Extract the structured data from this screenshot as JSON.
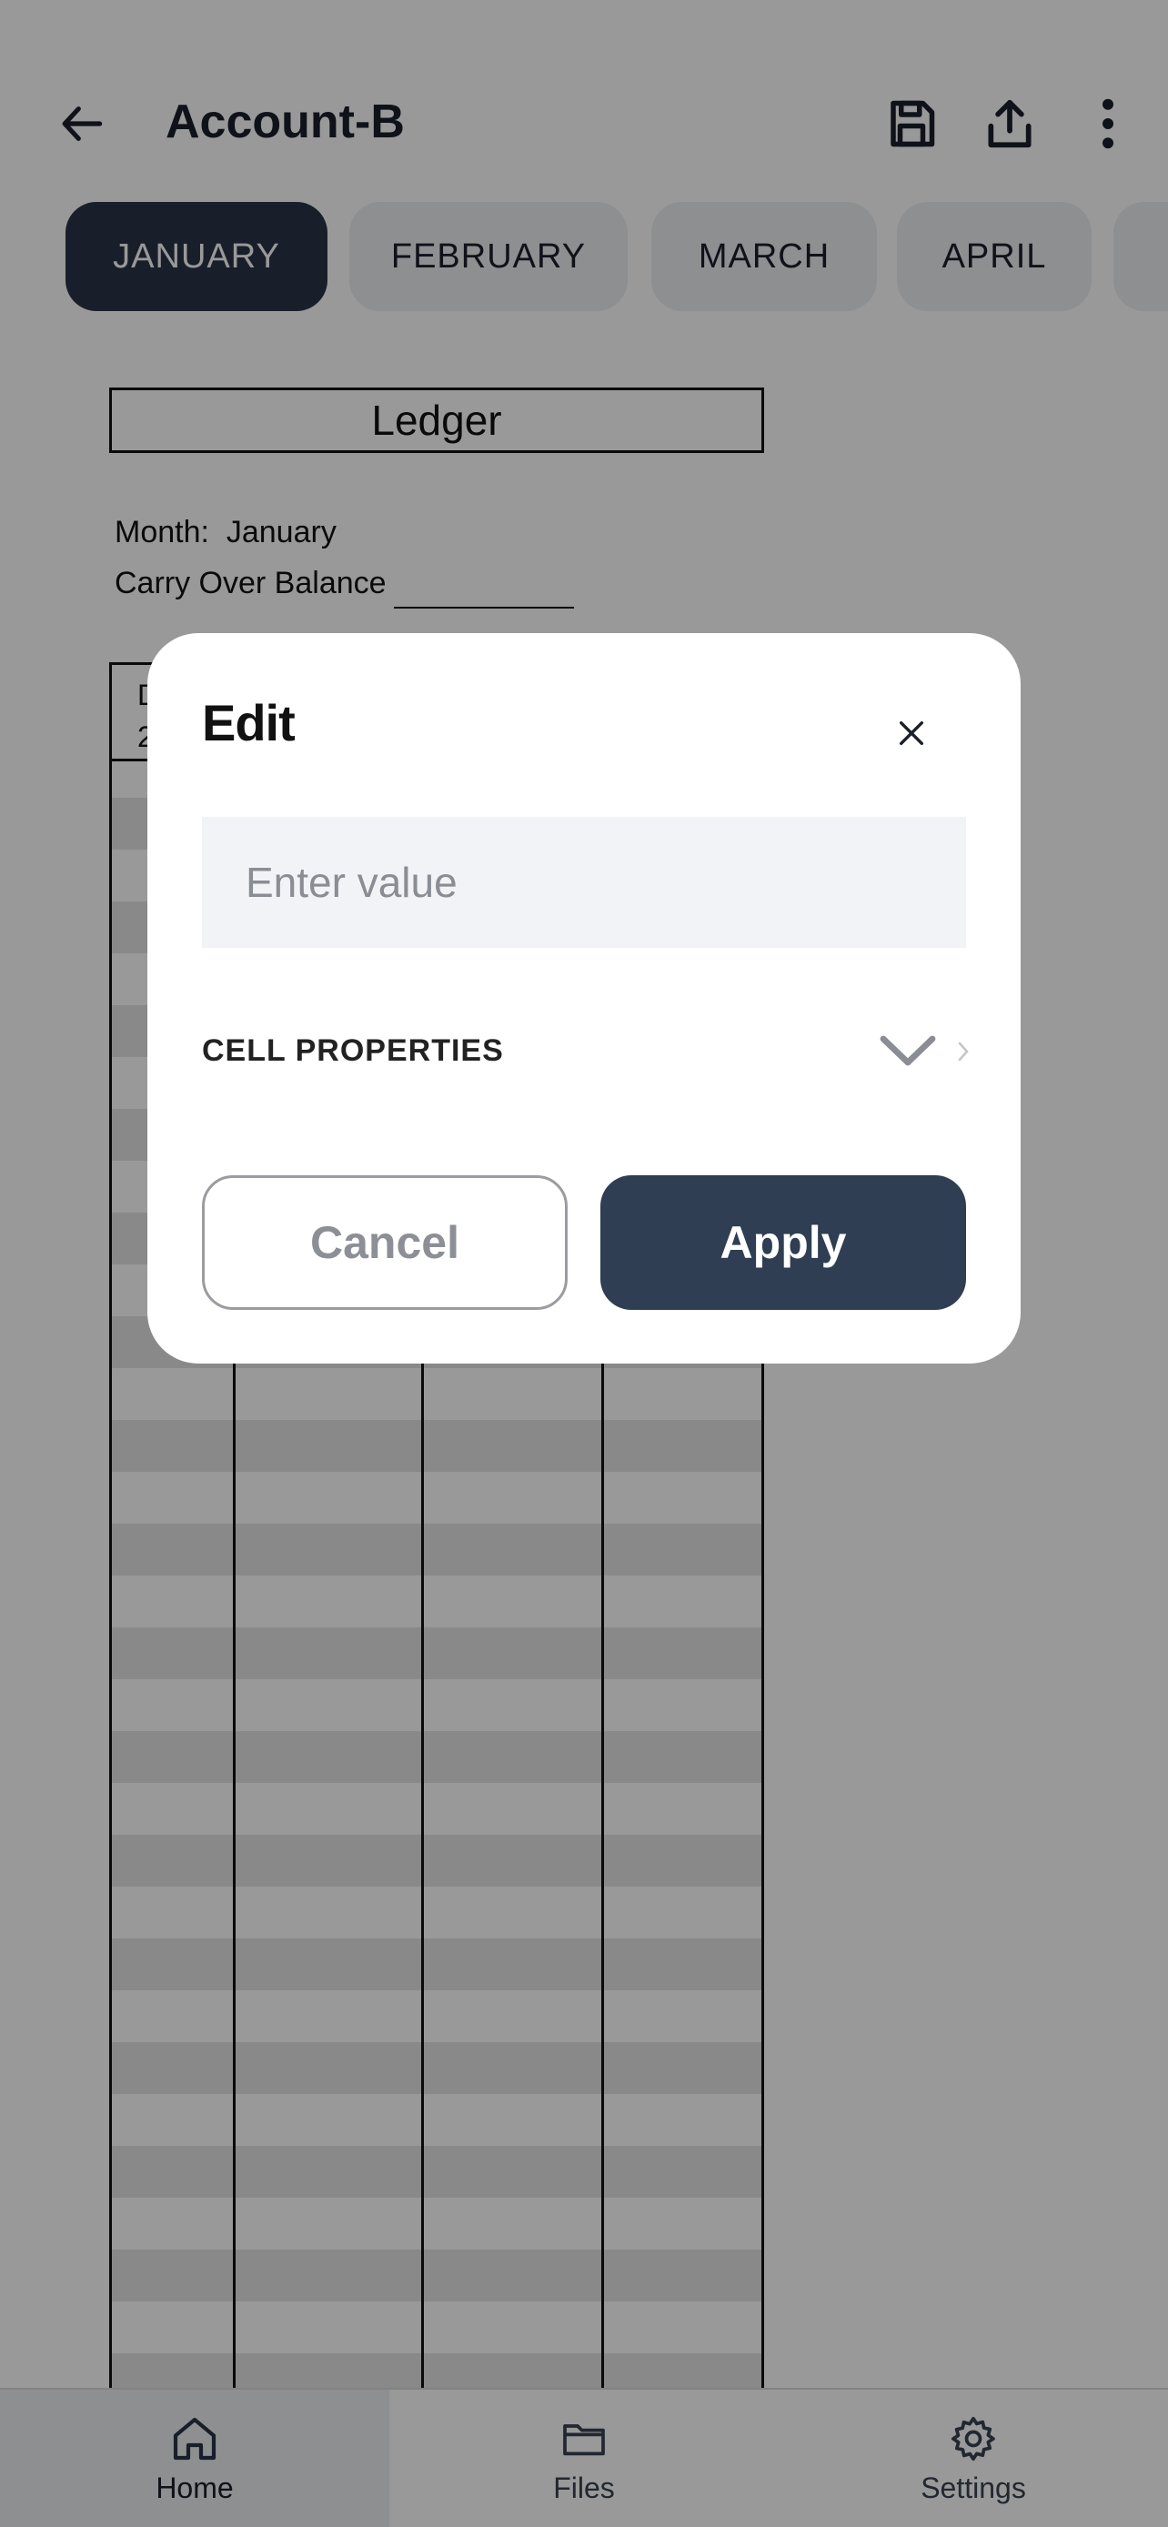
{
  "header": {
    "title": "Account-B",
    "icons": [
      "back-arrow-icon",
      "save-icon",
      "share-icon",
      "more-vertical-icon"
    ]
  },
  "tabs": [
    {
      "label": "JANUARY",
      "active": true
    },
    {
      "label": "FEBRUARY",
      "active": false
    },
    {
      "label": "MARCH",
      "active": false
    },
    {
      "label": "APRIL",
      "active": false
    }
  ],
  "sheet": {
    "ledger_title": "Ledger",
    "month_label": "Month:",
    "month_value": "January",
    "carry_over_label": "Carry Over Balance",
    "table_head_line1": "D",
    "table_head_line2": "2"
  },
  "dialog": {
    "title": "Edit",
    "input_placeholder": "Enter value",
    "input_value": "",
    "cell_properties_label": "CELL PROPERTIES",
    "cancel_label": "Cancel",
    "apply_label": "Apply"
  },
  "bottom_nav": [
    {
      "label": "Home",
      "icon": "home-icon",
      "active": true
    },
    {
      "label": "Files",
      "icon": "folder-icon",
      "active": false
    },
    {
      "label": "Settings",
      "icon": "gear-icon",
      "active": false
    }
  ],
  "colors": {
    "primary_dark": "#2b3547",
    "apply_button": "#2f3e52",
    "tab_inactive": "#eceef1",
    "overlay": "rgba(0,0,0,0.40)"
  }
}
